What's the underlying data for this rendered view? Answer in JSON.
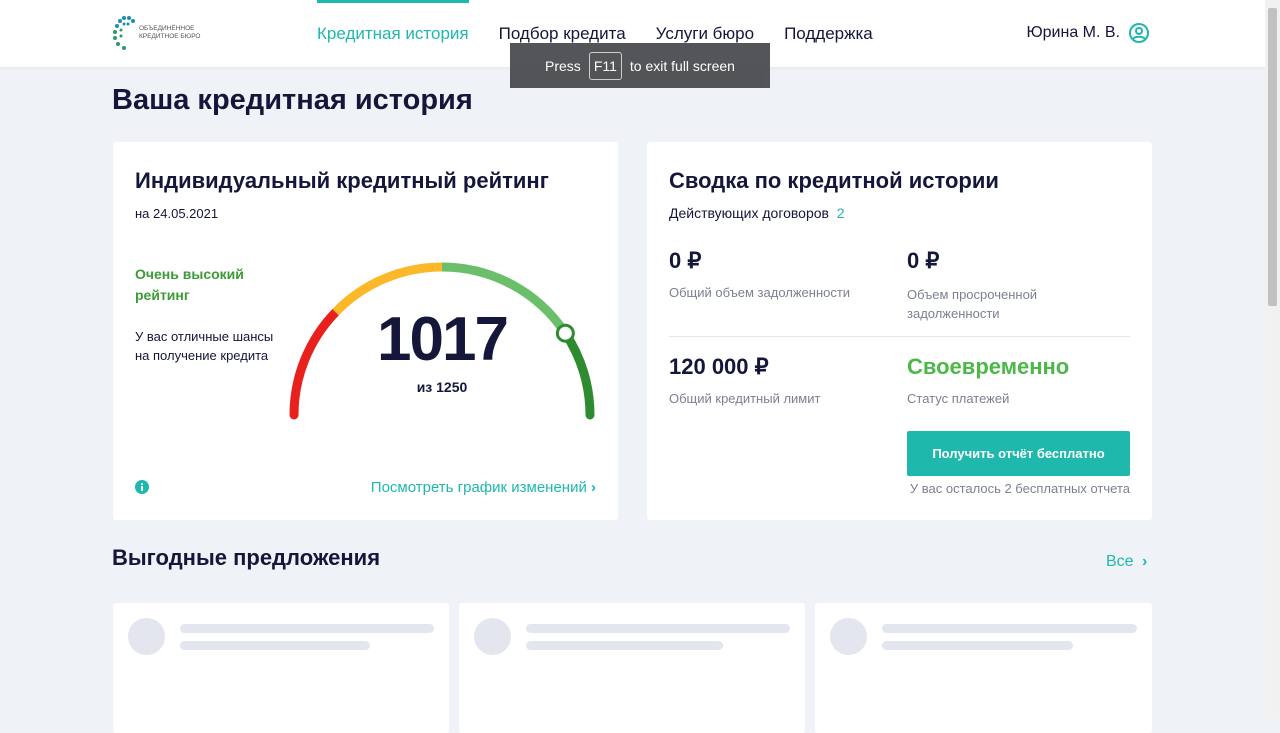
{
  "header": {
    "logo_text": "Объединённое кредитное бюро",
    "nav": [
      "Кредитная история",
      "Подбор кредита",
      "Услуги бюро",
      "Поддержка"
    ],
    "active_nav": 0,
    "user": "Юрина М. В.",
    "accent": "#1fb8ad"
  },
  "toast": {
    "pre": "Press",
    "key": "F11",
    "post": "to exit full screen"
  },
  "page_title": "Ваша кредитная история",
  "rating": {
    "title": "Индивидуальный кредитный рейтинг",
    "date": "на 24.05.2021",
    "level": "Очень высокий рейтинг",
    "description": "У вас отличные шансы на получение кредита",
    "score": "1017",
    "max_label": "из 1250",
    "score_value": 1017,
    "score_max": 1250,
    "link": "Посмотреть график изменений"
  },
  "summary": {
    "title": "Сводка по кредитной истории",
    "contracts_label": "Действующих договоров",
    "contracts_count": "2",
    "total_debt": "0 ₽",
    "total_debt_label": "Общий объем задолженности",
    "overdue": "0 ₽",
    "overdue_label": "Объем просроченной задолженности",
    "limit": "120 000 ₽",
    "limit_label": "Общий кредитный лимит",
    "status": "Своевременно",
    "status_label": "Статус платежей",
    "button": "Получить отчёт бесплатно",
    "remaining": "У вас осталось 2 бесплатных отчета"
  },
  "offers": {
    "title": "Выгодные предложения",
    "all": "Все"
  }
}
